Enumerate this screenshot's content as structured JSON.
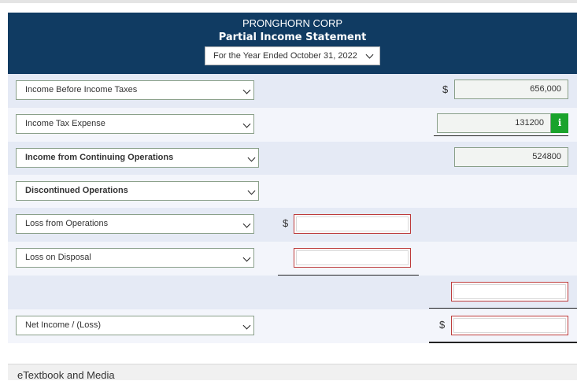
{
  "header": {
    "company": "PRONGHORN CORP",
    "statement": "Partial Income Statement",
    "period": "For the Year Ended October 31, 2022"
  },
  "rows": [
    {
      "label": "Income Before Income Taxes",
      "amount": "656,000",
      "currency": "$"
    },
    {
      "label": "Income Tax Expense",
      "amount": "131200",
      "info": "i"
    },
    {
      "label": "Income from Continuing Operations",
      "amount": "524800"
    },
    {
      "label": "Discontinued Operations"
    },
    {
      "label": "Loss from Operations",
      "currency": "$",
      "amount": ""
    },
    {
      "label": "Loss on Disposal",
      "amount": ""
    },
    {
      "amount": ""
    },
    {
      "label": "Net Income / (Loss)",
      "currency": "$",
      "amount": ""
    }
  ],
  "footer": {
    "textbook": "eTextbook and Media"
  }
}
